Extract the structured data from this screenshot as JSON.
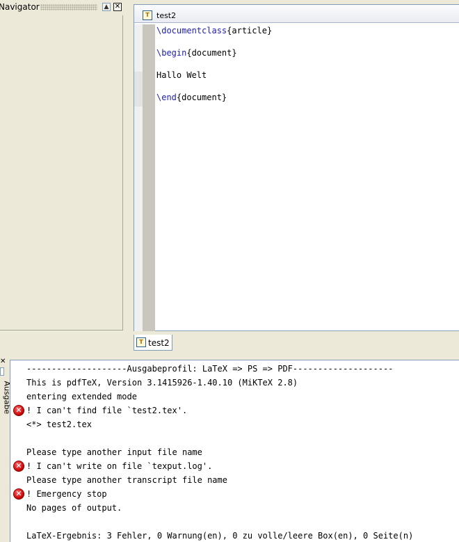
{
  "navigator": {
    "title": "Navigator",
    "collapse_label": "▲",
    "close_label": "✕"
  },
  "editor": {
    "title": "T",
    "document_name": "test2",
    "code_lines": [
      {
        "kw": "\\documentclass",
        "rest": "{article}"
      },
      {
        "kw": "",
        "rest": ""
      },
      {
        "kw": "\\begin",
        "rest": "{document}"
      },
      {
        "kw": "",
        "rest": ""
      },
      {
        "kw": "",
        "rest": "Hallo Welt"
      },
      {
        "kw": "",
        "rest": ""
      },
      {
        "kw": "\\end",
        "rest": "{document}"
      }
    ]
  },
  "tabs": {
    "doc_tab_label": "test2"
  },
  "output": {
    "close_label": "✕",
    "side_label": "Ausgabe",
    "lines": [
      {
        "text": "--------------------Ausgabeprofil: LaTeX => PS => PDF--------------------",
        "error": false
      },
      {
        "text": "This is pdfTeX, Version 3.1415926-1.40.10 (MiKTeX 2.8)",
        "error": false
      },
      {
        "text": "entering extended mode",
        "error": false
      },
      {
        "text": "! I can't find file `test2.tex'.",
        "error": true
      },
      {
        "text": "<*> test2.tex",
        "error": false
      },
      {
        "text": "",
        "error": false
      },
      {
        "text": "Please type another input file name",
        "error": false
      },
      {
        "text": "! I can't write on file `texput.log'.",
        "error": true
      },
      {
        "text": "Please type another transcript file name",
        "error": false
      },
      {
        "text": "! Emergency stop",
        "error": true
      },
      {
        "text": "No pages of output.",
        "error": false
      },
      {
        "text": "",
        "error": false
      },
      {
        "text": "LaTeX-Ergebnis: 3 Fehler, 0 Warnung(en), 0 zu volle/leere Box(en), 0 Seite(n)",
        "error": false
      }
    ]
  },
  "colors": {
    "keyword": "#1c1cb4",
    "error": "#c60000",
    "chrome": "#ece9d8"
  }
}
